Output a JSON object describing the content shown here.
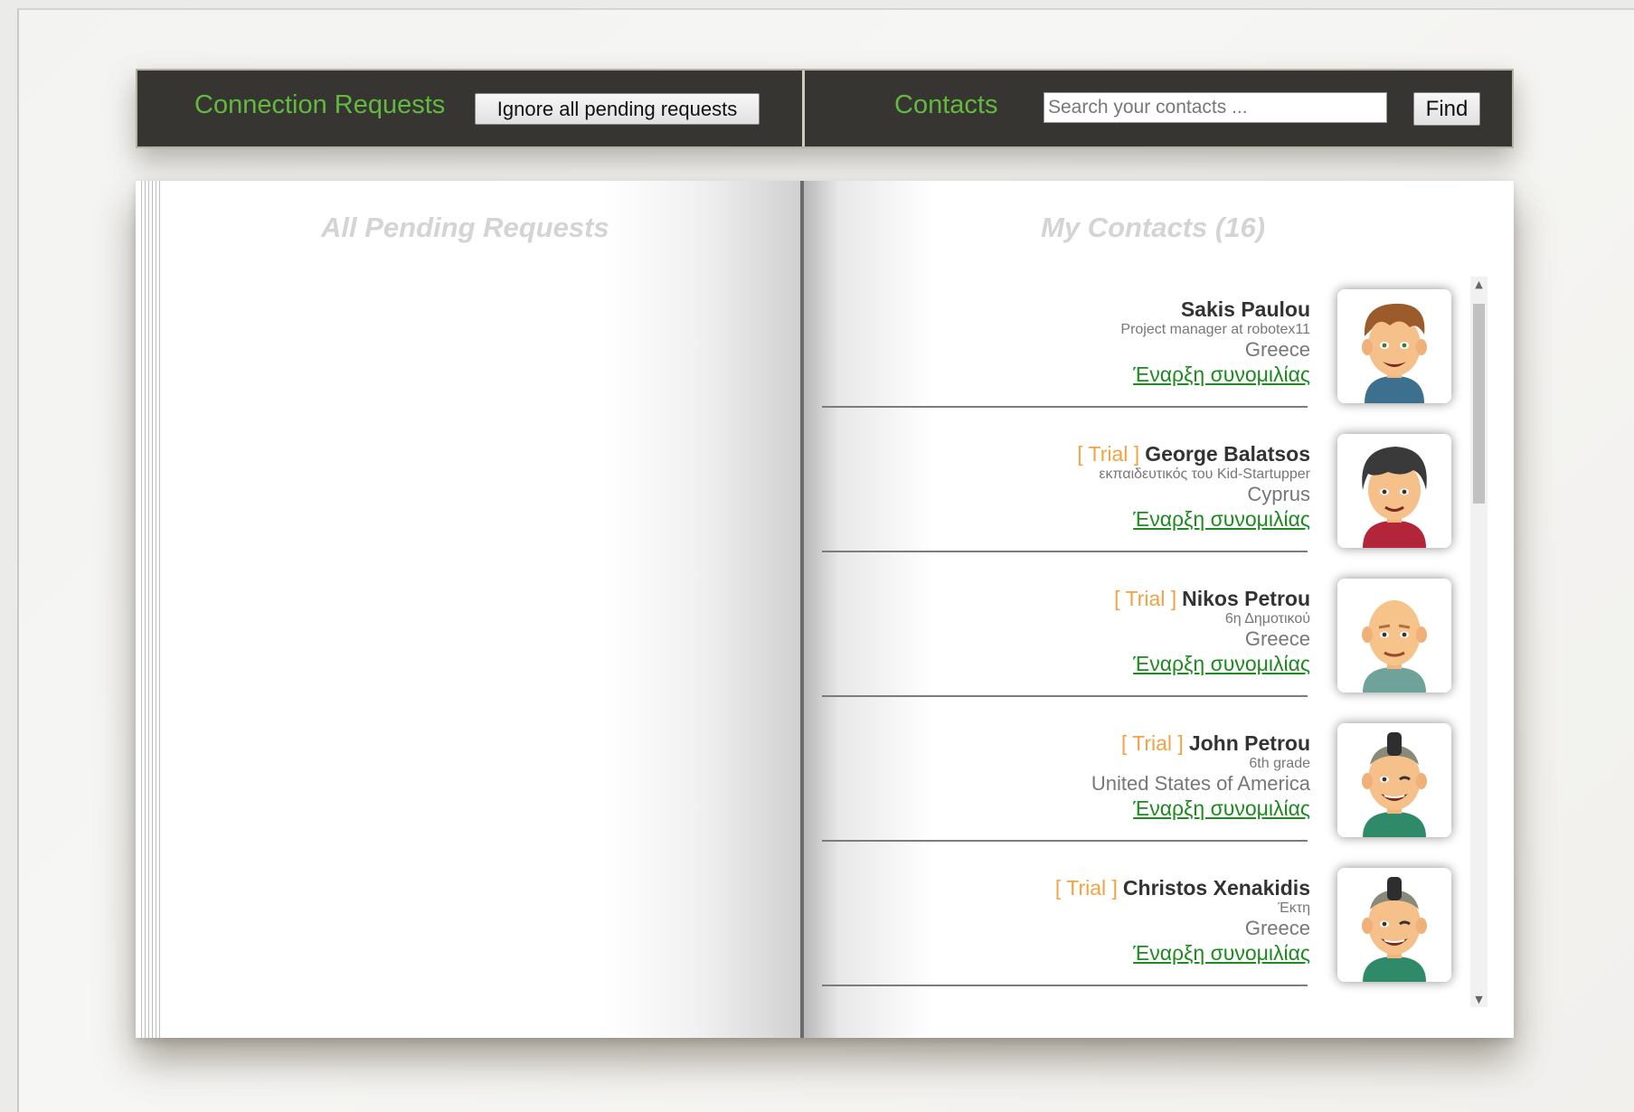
{
  "toolbar": {
    "requests_title": "Connection Requests",
    "ignore_button": "Ignore all pending requests",
    "contacts_title": "Contacts",
    "search_placeholder": "Search your contacts ...",
    "search_value": "",
    "find_button": "Find"
  },
  "left_page": {
    "heading": "All Pending Requests",
    "requests": []
  },
  "right_page": {
    "heading": "My Contacts (16)",
    "contacts": [
      {
        "trial": "",
        "name": "Sakis Paulou",
        "job": "Project manager at robotex11",
        "country": "Greece",
        "chat_link": "Έναρξη συνομιλίας",
        "avatar": "avatar-brown-hair-boy"
      },
      {
        "trial": "[ Trial ]",
        "name": "George Balatsos",
        "job": "εκπαιδευτικός του Kid-Startupper",
        "country": "Cyprus",
        "chat_link": "Έναρξη συνομιλίας",
        "avatar": "avatar-dark-hair-boy"
      },
      {
        "trial": "[ Trial ]",
        "name": "Nikos Petrou",
        "job": "6η Δημοτικού",
        "country": "Greece",
        "chat_link": "Έναρξη συνομιλίας",
        "avatar": "avatar-bald-man"
      },
      {
        "trial": "[ Trial ]",
        "name": "John Petrou",
        "job": "6th grade",
        "country": "United States of America",
        "chat_link": "Έναρξη συνομιλίας",
        "avatar": "avatar-mohawk-winking"
      },
      {
        "trial": "[ Trial ]",
        "name": "Christos Xenakidis",
        "job": "Έκτη",
        "country": "Greece",
        "chat_link": "Έναρξη συνομιλίας",
        "avatar": "avatar-mohawk-winking"
      }
    ]
  },
  "colors": {
    "title_green": "#62b940",
    "trial_orange": "#f1a344",
    "chat_green": "#1d8a1d",
    "toolbar_bg": "#363532"
  }
}
